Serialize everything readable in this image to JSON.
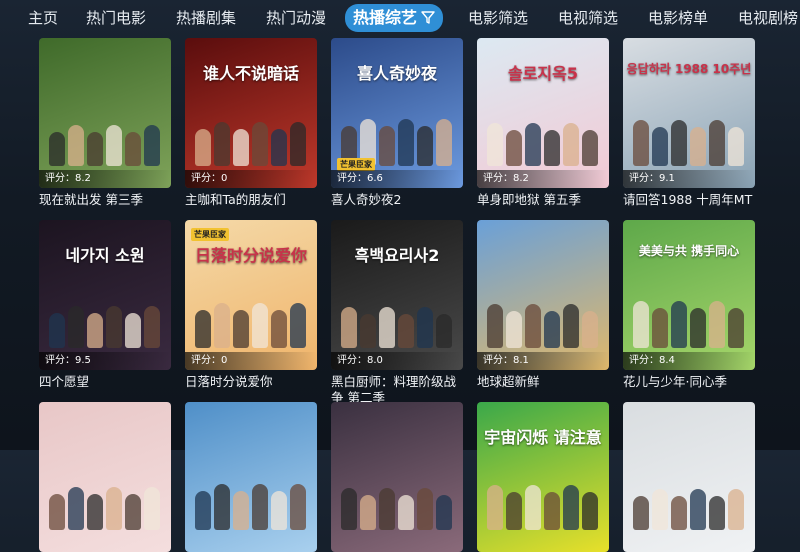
{
  "nav": {
    "items": [
      {
        "label": "主页"
      },
      {
        "label": "热门电影"
      },
      {
        "label": "热播剧集"
      },
      {
        "label": "热门动漫"
      },
      {
        "label": "热播综艺",
        "active": true
      },
      {
        "label": "电影筛选"
      },
      {
        "label": "电视筛选"
      },
      {
        "label": "电影榜单"
      },
      {
        "label": "电视剧榜"
      }
    ],
    "filter_icon": "filter-funnel-icon",
    "accent": "#2f8fd6"
  },
  "score_prefix": "评分：",
  "shows": [
    {
      "title": "现在就出发 第三季",
      "score": "8.2",
      "colors": [
        "#3f6a2a",
        "#7fa35a"
      ],
      "poster_text": ""
    },
    {
      "title": "主咖和Ta的朋友们",
      "score": "0",
      "colors": [
        "#5a0d0d",
        "#c0392b"
      ],
      "poster_text": "谁人不说暗话"
    },
    {
      "title": "喜人奇妙夜2",
      "score": "6.6",
      "colors": [
        "#2c4b8a",
        "#6d9be0"
      ],
      "poster_text": "喜人奇妙夜",
      "badge": "芒果臣家"
    },
    {
      "title": "单身即地狱 第五季",
      "score": "8.2",
      "colors": [
        "#dce9f2",
        "#f3c9d4"
      ],
      "poster_text": "솔로지옥5"
    },
    {
      "title": "请回答1988 十周年MT",
      "score": "9.1",
      "colors": [
        "#d8dde2",
        "#8aa3b5"
      ],
      "poster_text": "응답하라 1988 10주년"
    },
    {
      "title": "四个愿望",
      "score": "9.5",
      "colors": [
        "#1c1420",
        "#3a2a40"
      ],
      "poster_text": "네가지 소원"
    },
    {
      "title": "日落时分说爱你",
      "score": "0",
      "colors": [
        "#f4d9a8",
        "#f0b46a"
      ],
      "poster_text": "日落时分说爱你",
      "badge": "芒果臣家"
    },
    {
      "title": "黑白厨师：料理阶级战争 第二季",
      "score": "8.0",
      "colors": [
        "#1a1a1a",
        "#4a4a4a"
      ],
      "poster_text": "흑백요리사2"
    },
    {
      "title": "地球超新鲜",
      "score": "8.1",
      "colors": [
        "#6aa0d8",
        "#e0b86a"
      ],
      "poster_text": ""
    },
    {
      "title": "花儿与少年·同心季",
      "score": "8.4",
      "colors": [
        "#5ea84a",
        "#a6d66a"
      ],
      "poster_text": "美美与共 携手同心"
    },
    {
      "title": "",
      "score": "",
      "colors": [
        "#e8c7c7",
        "#f4dede"
      ],
      "poster_text": ""
    },
    {
      "title": "",
      "score": "",
      "colors": [
        "#4f8fc8",
        "#a9d0ee"
      ],
      "poster_text": ""
    },
    {
      "title": "",
      "score": "",
      "colors": [
        "#3a3040",
        "#8a6a7a"
      ],
      "poster_text": ""
    },
    {
      "title": "",
      "score": "",
      "colors": [
        "#3aa84a",
        "#e8e02a"
      ],
      "poster_text": "宇宙闪烁 请注意"
    },
    {
      "title": "",
      "score": "",
      "colors": [
        "#d9dde0",
        "#f0f2f4"
      ],
      "poster_text": ""
    }
  ]
}
